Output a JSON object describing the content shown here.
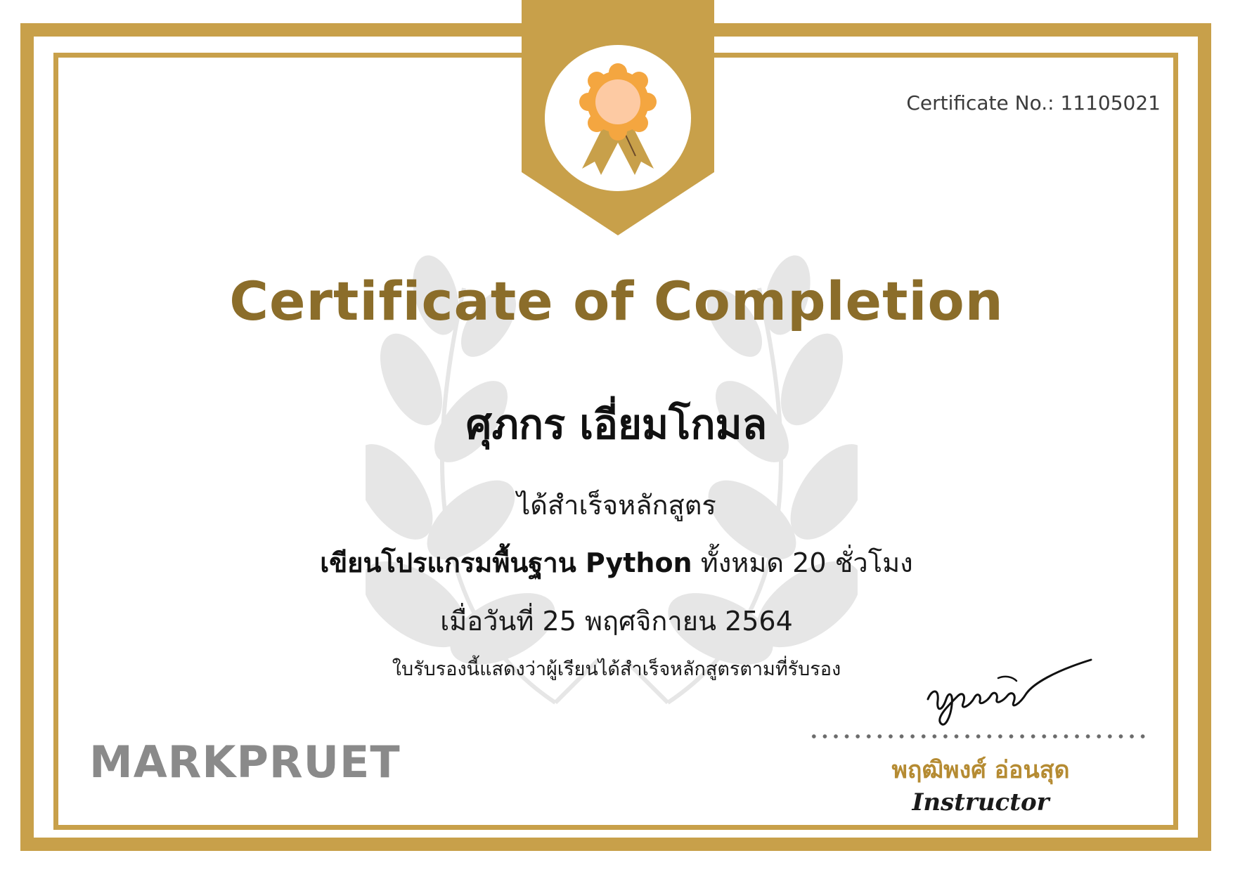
{
  "certificate": {
    "number_label": "Certificate No.: 11105021",
    "title": "Certificate of Completion",
    "recipient_name": "ศุภกร เอี่ยมโกมล",
    "line_completed": "ได้สำเร็จหลักสูตร",
    "course_name": "เขียนโปรแกรมพื้นฐาน Python",
    "course_duration": " ทั้งหมด 20 ชั่วโมง",
    "date_line": "เมื่อวันที่ 25 พฤศจิกายน 2564",
    "statement": "ใบรับรองนี้แสดงว่าผู้เรียนได้สำเร็จหลักสูตรตามที่รับรอง",
    "brand": "MARKPRUET",
    "signature_text": "พฤฒิพงศ์",
    "instructor_name": "พฤฒิพงศ์ อ่อนสุด",
    "instructor_role": "Instructor"
  },
  "colors": {
    "gold_border": "#c8a04a",
    "title_gold": "#8b6d2a",
    "rosette_orange": "#f4a640",
    "rosette_center": "#fdcaa3",
    "laurel_gray": "#e6e6e6",
    "brand_gray": "#8a8a8a",
    "instructor_gold": "#b58b32"
  },
  "icons": {
    "badge": "award-rosette-icon",
    "background": "laurel-wreath-icon"
  }
}
